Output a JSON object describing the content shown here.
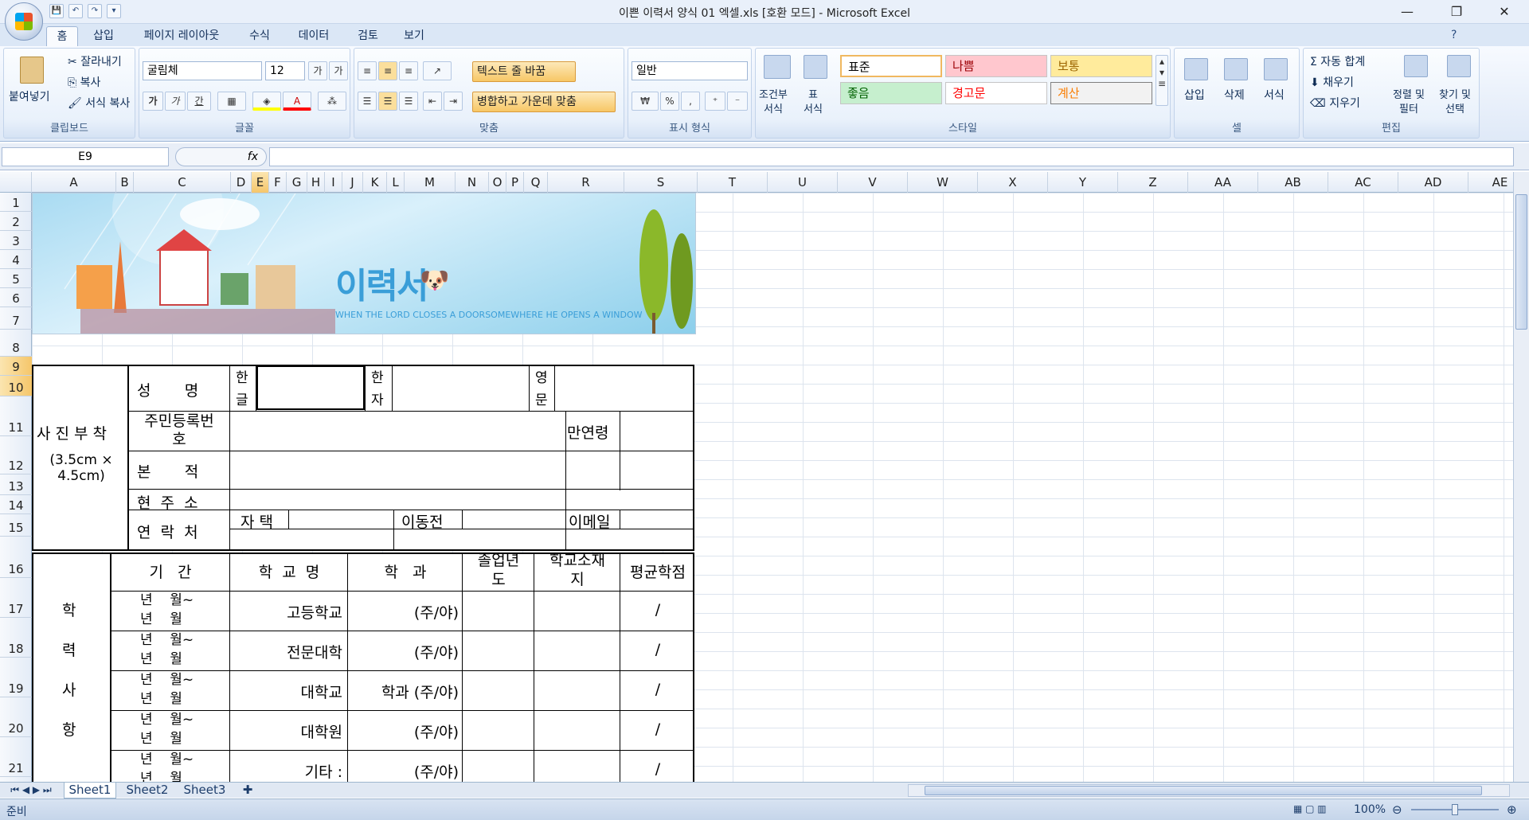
{
  "window": {
    "title": "이쁜 이력서 양식 01 엑셀.xls  [호환 모드] - Microsoft Excel",
    "controls": {
      "minimize": "—",
      "restore": "❐",
      "close": "✕"
    }
  },
  "qat": {
    "save": "💾",
    "undo": "↶",
    "redo": "↷",
    "more": "▾"
  },
  "ribbon_tabs": [
    "홈",
    "삽입",
    "페이지 레이아웃",
    "수식",
    "데이터",
    "검토",
    "보기"
  ],
  "ribbon": {
    "clipboard": {
      "label": "클립보드",
      "paste": "붙여넣기",
      "cut": "잘라내기",
      "copy": "복사",
      "format_painter": "서식 복사"
    },
    "font": {
      "label": "글꼴",
      "name": "굴림체",
      "size": "12",
      "grow": "가",
      "shrink": "가",
      "bold": "가",
      "italic": "가",
      "underline": "간"
    },
    "alignment": {
      "label": "맞춤",
      "wrap": "텍스트 줄 바꿈",
      "merge": "병합하고 가운데 맞춤"
    },
    "number": {
      "label": "표시 형식",
      "format": "일반",
      "currency": "₩",
      "percent": "%",
      "comma": ","
    },
    "styles": {
      "label": "스타일",
      "conditional": "조건부\n서식",
      "table": "표\n서식",
      "normal": "표준",
      "bad": "나쁨",
      "neutral": "보통",
      "good": "좋음",
      "warning": "경고문",
      "calc": "계산"
    },
    "cells": {
      "label": "셀",
      "insert": "삽입",
      "delete": "삭제",
      "format": "서식"
    },
    "editing": {
      "label": "편집",
      "autosum": "Σ 자동 합계",
      "fill": "채우기",
      "clear": "지우기",
      "sort": "정렬 및\n필터",
      "find": "찾기 및\n선택"
    }
  },
  "formula_bar": {
    "name_box": "E9",
    "fx": "fx",
    "content": ""
  },
  "columns": [
    "A",
    "B",
    "C",
    "D",
    "E",
    "F",
    "G",
    "H",
    "I",
    "J",
    "K",
    "L",
    "M",
    "N",
    "O",
    "P",
    "Q",
    "R",
    "S",
    "T",
    "U",
    "V",
    "W",
    "X",
    "Y",
    "Z",
    "AA",
    "AB",
    "AC",
    "AD",
    "AE"
  ],
  "rows": [
    "1",
    "2",
    "3",
    "4",
    "5",
    "6",
    "7",
    "8",
    "9",
    "10",
    "11",
    "12",
    "13",
    "14",
    "15",
    "16",
    "17",
    "18",
    "19",
    "20",
    "21"
  ],
  "banner": {
    "title": "이력서",
    "subtitle": "WHEN THE LORD CLOSES A DOORSOMEWHERE HE OPENS A WINDOW"
  },
  "form": {
    "photo_label": "사 진 부 착",
    "photo_size": "(3.5cm × 4.5cm)",
    "name_label": "성       명",
    "hangul": "한\n글",
    "hanja": "한\n자",
    "english": "영\n문",
    "id_number": "주민등록번\n호",
    "age": "만연령",
    "origin": "본       적",
    "address": "현  주  소",
    "contact": "연  락  처",
    "home": "자 택",
    "mobile": "이동전",
    "email": "이메일"
  },
  "education": {
    "side_label": [
      "학",
      "력",
      "사",
      "항"
    ],
    "headers": [
      "기   간",
      "학  교  명",
      "학   과",
      "졸업년\n도",
      "학교소재\n지",
      "평균학점"
    ],
    "period": "년    월~\n년    월",
    "rows": [
      {
        "school": "고등학교",
        "major": "(주/야)",
        "gpa": "/"
      },
      {
        "school": "전문대학",
        "major": "(주/야)",
        "gpa": "/"
      },
      {
        "school": "대학교",
        "major": "학과 (주/야)",
        "gpa": "/"
      },
      {
        "school": "대학원",
        "major": "(주/야)",
        "gpa": "/"
      },
      {
        "school": "기타 :",
        "major": "(주/야)",
        "gpa": "/"
      }
    ]
  },
  "sheets": [
    "Sheet1",
    "Sheet2",
    "Sheet3"
  ],
  "status": {
    "ready": "준비",
    "zoom": "100%"
  }
}
